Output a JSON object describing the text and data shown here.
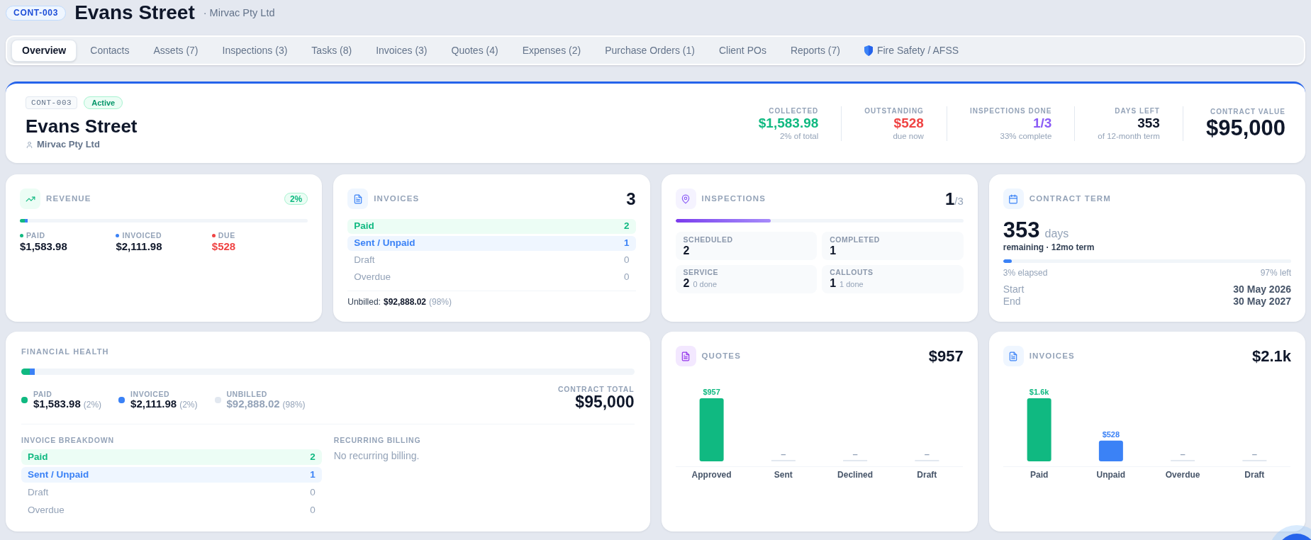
{
  "header": {
    "code": "CONT-003",
    "title": "Evans Street",
    "client": "· Mirvac Pty Ltd"
  },
  "tabs": [
    {
      "label": "Overview",
      "selected": true,
      "kind": "text"
    },
    {
      "label": "Contacts",
      "selected": false,
      "kind": "text"
    },
    {
      "label": "Assets (7)",
      "selected": false,
      "kind": "text"
    },
    {
      "label": "Inspections (3)",
      "selected": false,
      "kind": "text"
    },
    {
      "label": "Tasks (8)",
      "selected": false,
      "kind": "text"
    },
    {
      "label": "Invoices (3)",
      "selected": false,
      "kind": "text"
    },
    {
      "label": "Quotes (4)",
      "selected": false,
      "kind": "text"
    },
    {
      "label": "Expenses (2)",
      "selected": false,
      "kind": "text"
    },
    {
      "label": "Purchase Orders (1)",
      "selected": false,
      "kind": "text"
    },
    {
      "label": "Client POs",
      "selected": false,
      "kind": "text"
    },
    {
      "label": "Reports (7)",
      "selected": false,
      "kind": "text"
    },
    {
      "label": "Fire Safety / AFSS",
      "selected": false,
      "kind": "icon"
    }
  ],
  "summary": {
    "code": "CONT-003",
    "status": "Active",
    "title": "Evans Street",
    "client": "Mirvac Pty Ltd",
    "stats": [
      {
        "label": "COLLECTED",
        "value": "$1,583.98",
        "note": "2% of total",
        "color": "#10b981",
        "kind": "stat"
      },
      {
        "label": "OUTSTANDING",
        "value": "$528",
        "note": "due now",
        "color": "#ef4444",
        "kind": "stat"
      },
      {
        "label": "INSPECTIONS DONE",
        "value": "1/3",
        "note": "33% complete",
        "color": "#8b5cf6",
        "kind": "stat"
      },
      {
        "label": "DAYS LEFT",
        "value": "353",
        "note": "of 12-month term",
        "color": "#0f172a",
        "kind": "stat"
      },
      {
        "label": "CONTRACT VALUE",
        "value": "$95,000",
        "color": "#0f172a",
        "kind": "total"
      }
    ]
  },
  "revenue": {
    "title": "REVENUE",
    "badge": "2%",
    "bar": [
      {
        "level": 0.018,
        "color": "#10b981"
      },
      {
        "level": 0.009,
        "color": "#3b82f6"
      }
    ],
    "items": [
      {
        "label": "PAID",
        "value": "$1,583.98",
        "color": "#10b981",
        "kind": "plain"
      },
      {
        "label": "INVOICED",
        "value": "$2,111.98",
        "color": "#3b82f6",
        "kind": "plain"
      },
      {
        "label": "DUE",
        "value": "$528",
        "color": "#ef4444",
        "kind": "alert"
      }
    ]
  },
  "invoices": {
    "title": "INVOICES",
    "count": "3",
    "rows": [
      {
        "label": "Paid",
        "count": "2",
        "kind": "paid"
      },
      {
        "label": "Sent / Unpaid",
        "count": "1",
        "kind": "sent"
      },
      {
        "label": "Draft",
        "count": "0",
        "kind": "empty"
      },
      {
        "label": "Overdue",
        "count": "0",
        "kind": "empty"
      }
    ],
    "unbilled": {
      "label": "Unbilled:",
      "value": "$92,888.02",
      "share": "(98%)"
    }
  },
  "inspections": {
    "title": "INSPECTIONS",
    "done": "1",
    "total": "/3",
    "level": 0.33,
    "tiles": [
      {
        "label": "SCHEDULED",
        "value": "2"
      },
      {
        "label": "COMPLETED",
        "value": "1"
      },
      {
        "label": "SERVICE",
        "value": "2",
        "note": "0 done"
      },
      {
        "label": "CALLOUTS",
        "value": "1",
        "note": "1 done"
      }
    ]
  },
  "contract_term": {
    "title": "CONTRACT TERM",
    "days": "353",
    "unit": "days",
    "caption": "remaining · 12mo term",
    "level": 0.03,
    "elapsed": "3% elapsed",
    "left": "97% left",
    "dates": [
      {
        "label": "Start",
        "value": "30 May 2026"
      },
      {
        "label": "End",
        "value": "30 May 2027"
      }
    ]
  },
  "financial_health": {
    "title": "FINANCIAL HEALTH",
    "bar": [
      {
        "level": 0.014,
        "color": "#10b981"
      },
      {
        "level": 0.008,
        "color": "#3b82f6"
      }
    ],
    "legend": [
      {
        "label": "PAID",
        "value": "$1,583.98",
        "share": "(2%)",
        "color": "#10b981",
        "kind": "billed"
      },
      {
        "label": "INVOICED",
        "value": "$2,111.98",
        "share": "(2%)",
        "color": "#3b82f6",
        "kind": "billed"
      },
      {
        "label": "UNBILLED",
        "value": "$92,888.02",
        "share": "(98%)",
        "color": "#e2e8f0",
        "kind": "unbilled"
      }
    ],
    "total_label": "CONTRACT TOTAL",
    "total_value": "$95,000",
    "breakdown": {
      "title": "INVOICE BREAKDOWN",
      "rows": [
        {
          "label": "Paid",
          "count": "2",
          "kind": "paid"
        },
        {
          "label": "Sent / Unpaid",
          "count": "1",
          "kind": "sent"
        },
        {
          "label": "Draft",
          "count": "0",
          "kind": "empty"
        },
        {
          "label": "Overdue",
          "count": "0",
          "kind": "empty"
        }
      ]
    },
    "recurring": {
      "title": "RECURRING BILLING",
      "text": "No recurring billing."
    }
  },
  "quotes_chart": {
    "title": "QUOTES",
    "total": "$957",
    "chart_data": {
      "type": "bar",
      "categories": [
        "Approved",
        "Sent",
        "Declined",
        "Draft"
      ],
      "values": [
        957,
        0,
        0,
        0
      ],
      "value_labels": [
        "$957",
        "–",
        "–",
        "–"
      ]
    }
  },
  "invoices_chart": {
    "title": "INVOICES",
    "total": "$2.1k",
    "chart_data": {
      "type": "bar",
      "categories": [
        "Paid",
        "Unpaid",
        "Overdue",
        "Draft"
      ],
      "stacked": true,
      "series": [
        {
          "color": "#10b981",
          "values": [
            1600,
            null,
            null,
            null
          ],
          "value_labels": [
            "$1.6k",
            null,
            null,
            null
          ]
        },
        {
          "color": "#3b82f6",
          "values": [
            null,
            528,
            null,
            null
          ],
          "value_labels": [
            null,
            "$528",
            null,
            null
          ]
        },
        {
          "color": "#e2e8f0",
          "values": [
            null,
            null,
            0,
            0
          ],
          "value_labels": [
            null,
            null,
            "–",
            "–"
          ]
        }
      ]
    }
  }
}
